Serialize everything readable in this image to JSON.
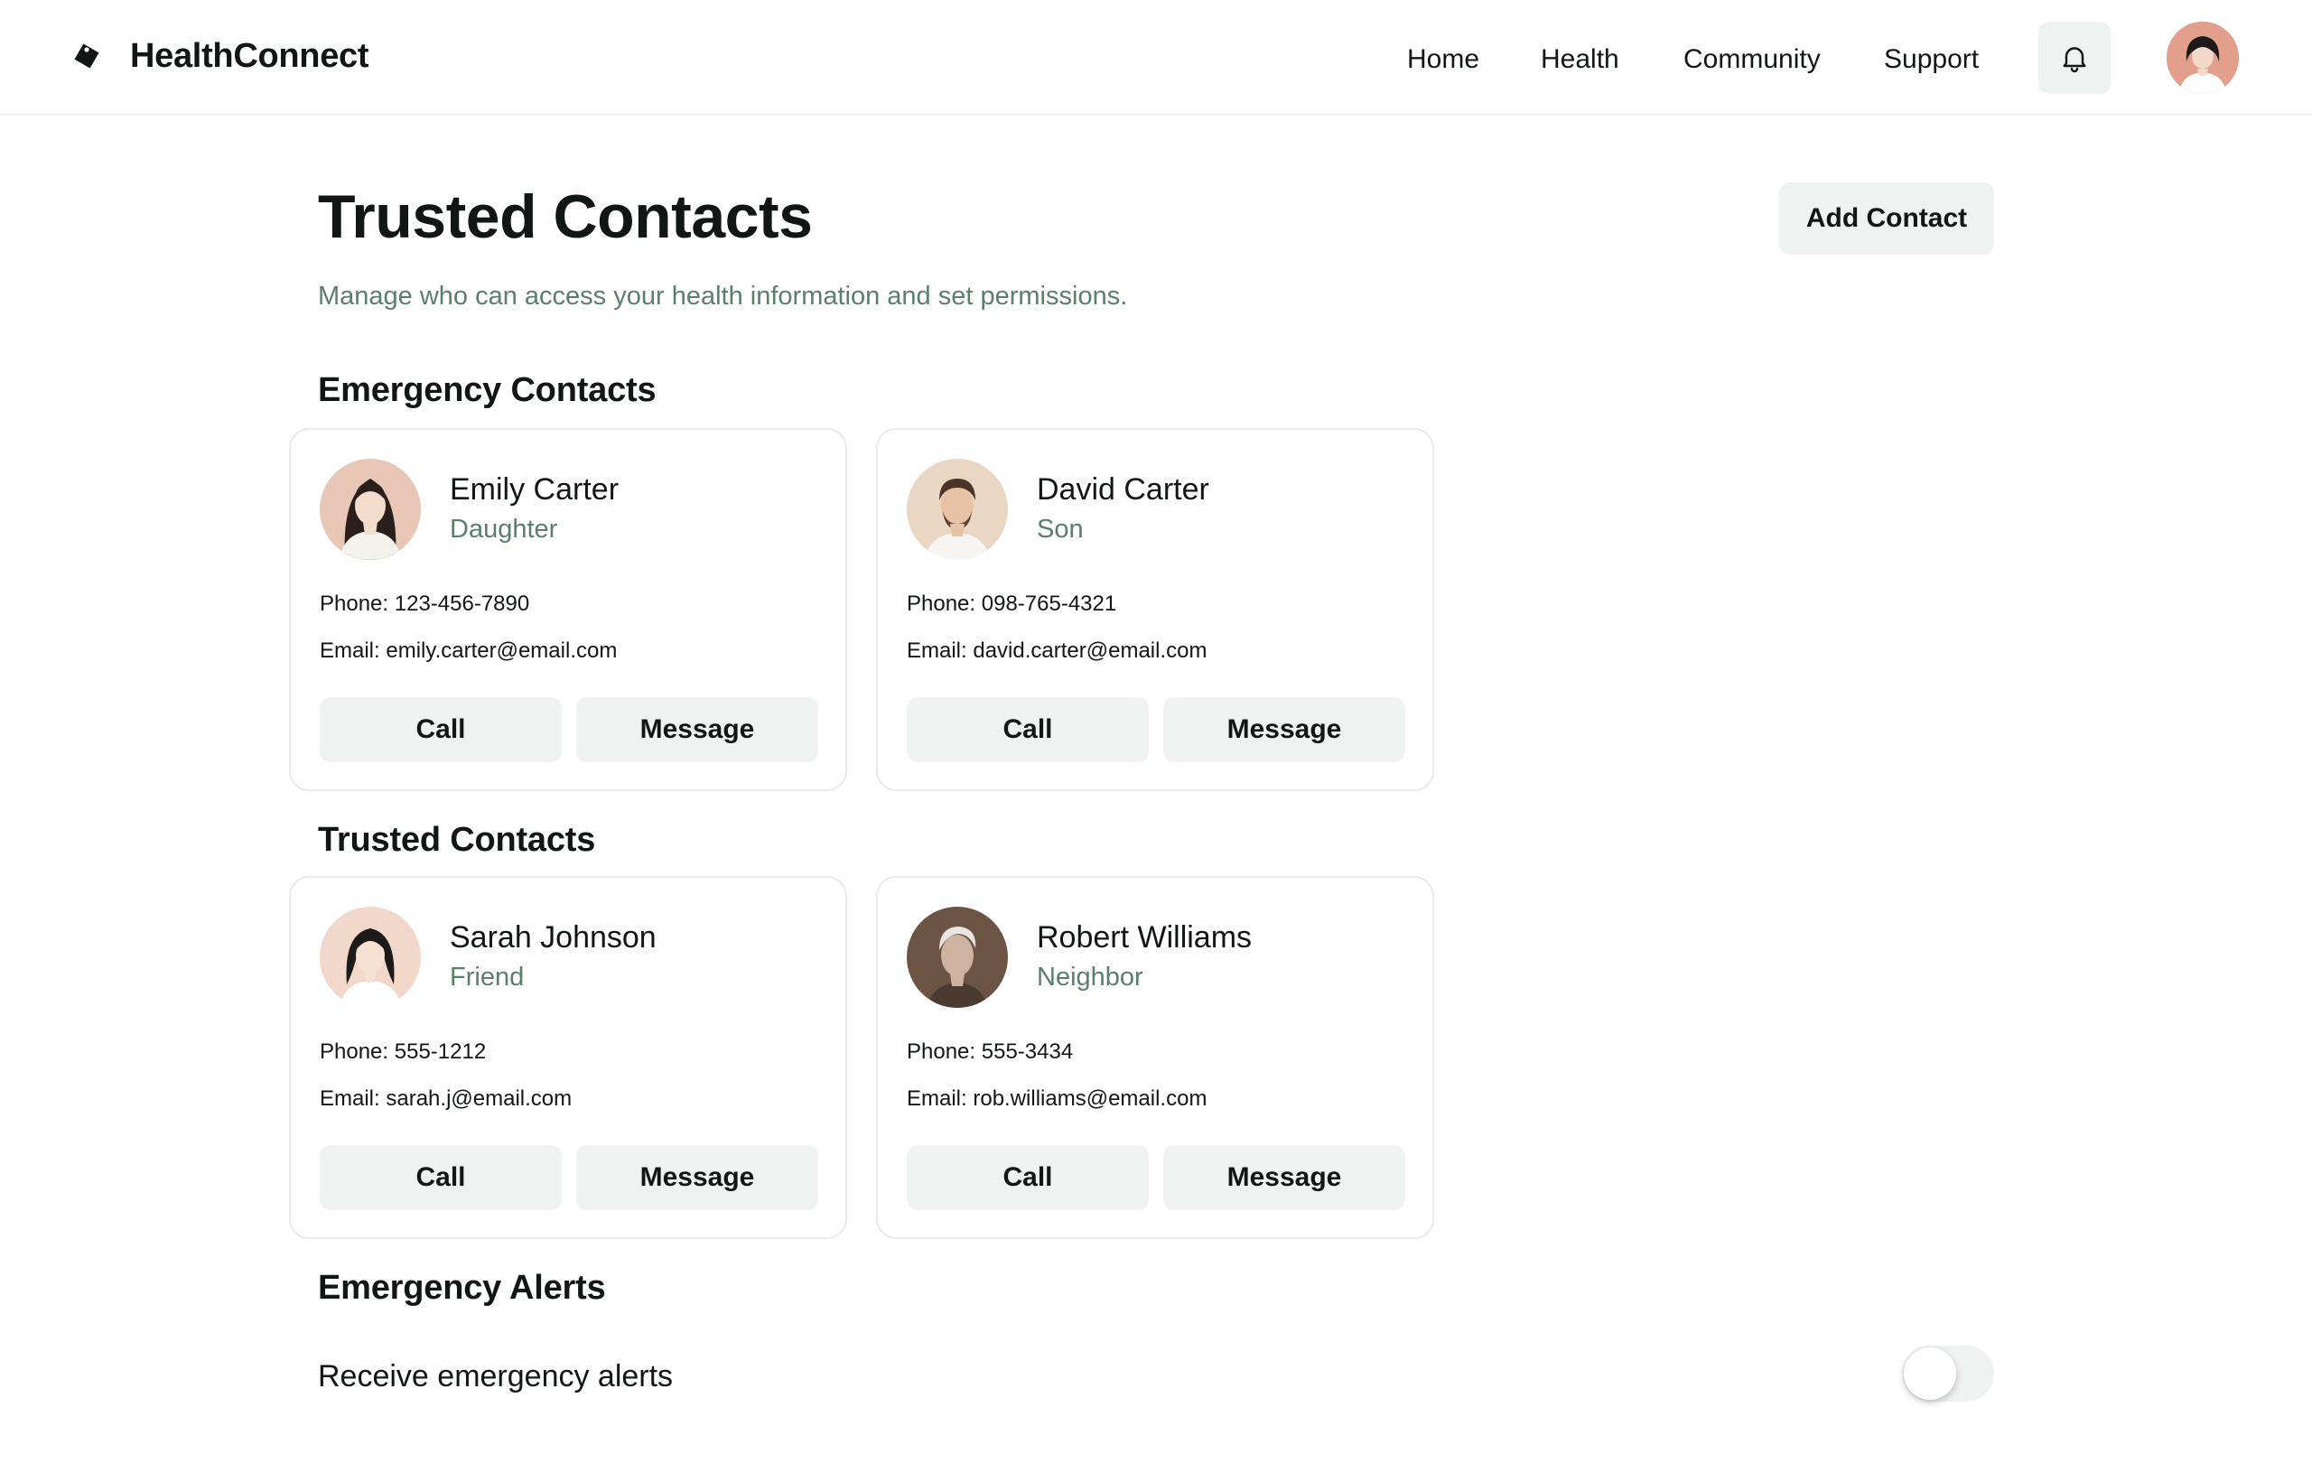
{
  "header": {
    "brand": "HealthConnect",
    "logo_icon": "tag-icon",
    "nav": [
      "Home",
      "Health",
      "Community",
      "Support"
    ],
    "notification_icon": "bell-icon"
  },
  "page": {
    "title": "Trusted Contacts",
    "subtitle": "Manage who can access your health information and set permissions.",
    "add_contact_label": "Add Contact"
  },
  "sections": {
    "emergency": "Emergency Contacts",
    "trusted": "Trusted Contacts",
    "alerts": "Emergency Alerts"
  },
  "contacts": [
    {
      "name": "Emily Carter",
      "relation": "Daughter",
      "phone_label": "Phone:",
      "phone": "123-456-7890",
      "email_label": "Email:",
      "email": "emily.carter@email.com",
      "call_label": "Call",
      "message_label": "Message"
    },
    {
      "name": "David Carter",
      "relation": "Son",
      "phone_label": "Phone:",
      "phone": "098-765-4321",
      "email_label": "Email:",
      "email": "david.carter@email.com",
      "call_label": "Call",
      "message_label": "Message"
    },
    {
      "name": "Sarah Johnson",
      "relation": "Friend",
      "phone_label": "Phone:",
      "phone": "555-1212",
      "email_label": "Email:",
      "email": "sarah.j@email.com",
      "call_label": "Call",
      "message_label": "Message"
    },
    {
      "name": "Robert Williams",
      "relation": "Neighbor",
      "phone_label": "Phone:",
      "phone": "555-3434",
      "email_label": "Email:",
      "email": "rob.williams@email.com",
      "call_label": "Call",
      "message_label": "Message"
    }
  ],
  "alerts": {
    "label": "Receive emergency alerts",
    "enabled": false
  },
  "colors": {
    "accent_text": "#5b7f6a",
    "button_bg": "#eef2f1",
    "text": "#121614"
  }
}
